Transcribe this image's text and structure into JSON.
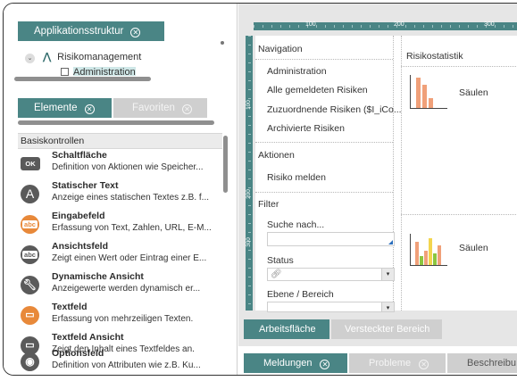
{
  "left_panel": {
    "structure_tab": "Applikationsstruktur",
    "tree": {
      "root": "Risikomanagement",
      "child": "Administration"
    },
    "tabs": {
      "elements": "Elemente",
      "favorites": "Favoriten"
    },
    "list_header": "Basiskontrollen",
    "items": [
      {
        "icon": "OK",
        "color": "#5a5a5a",
        "title": "Schaltfläche",
        "desc": "Definition von Aktionen wie Speicher..."
      },
      {
        "icon": "A",
        "color": "#5a5a5a",
        "title": "Statischer Text",
        "desc": "Anzeige eines statischen Textes z.B. f..."
      },
      {
        "icon": "abc",
        "color": "#e8893a",
        "title": "Eingabefeld",
        "desc": "Erfassung von Text, Zahlen, URL, E-M..."
      },
      {
        "icon": "abc",
        "color": "#5a5a5a",
        "title": "Ansichtsfeld",
        "desc": "Zeigt einen Wert oder Eintrag einer E..."
      },
      {
        "icon": "wrench",
        "color": "#5a5a5a",
        "title": "Dynamische Ansicht",
        "desc": "Anzeigewerte werden dynamisch er..."
      },
      {
        "icon": "edit",
        "color": "#e8893a",
        "title": "Textfeld",
        "desc": "Erfassung von mehrzeiligen Texten."
      },
      {
        "icon": "view",
        "color": "#5a5a5a",
        "title": "Textfeld Ansicht",
        "desc": "Zeigt den Inhalt eines Textfeldes an."
      },
      {
        "icon": "radio",
        "color": "#5a5a5a",
        "title": "Optionsfeld",
        "desc": "Definition von Attributen wie z.B. Ku..."
      }
    ]
  },
  "canvas": {
    "ruler_top": [
      "100",
      "200",
      "300"
    ],
    "ruler_left": [
      "100",
      "200",
      "300"
    ],
    "navigation": {
      "label": "Navigation",
      "links": [
        "Administration",
        "Alle gemeldeten Risiken",
        "Zuzuordnende Risiken ($I_iCo...",
        "Archivierte Risiken"
      ]
    },
    "actions": {
      "label": "Aktionen",
      "links": [
        "Risiko melden"
      ]
    },
    "filter": {
      "label": "Filter",
      "search_label": "Suche nach...",
      "status_label": "Status",
      "level_label": "Ebene / Bereich"
    },
    "stats": {
      "title": "Risikostatistik",
      "chart1_label": "Säulen",
      "chart2_label": "Säulen"
    }
  },
  "bottom_tabs": {
    "workspace": "Arbeitsfläche",
    "hidden": "Versteckter Bereich"
  },
  "footer_tabs": {
    "messages": "Meldungen",
    "problems": "Probleme",
    "description": "Beschreibu"
  },
  "colors": {
    "accent": "#4a8585",
    "orange": "#e8893a",
    "green": "#8cc63f",
    "yellow": "#f3d54e"
  }
}
